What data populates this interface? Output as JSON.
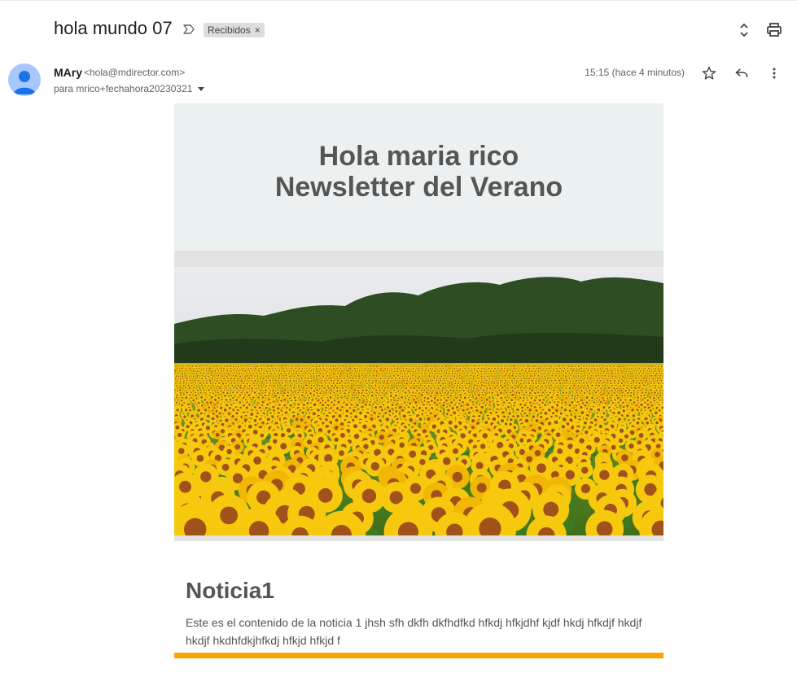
{
  "subject": "hola mundo 07",
  "label_chip": {
    "text": "Recibidos",
    "remove": "×"
  },
  "sender": {
    "name": "MAry",
    "email": "<hola@mdirector.com>",
    "recipient": "para mrico+fechahora20230321"
  },
  "timestamp": "15:15 (hace 4 minutos)",
  "icons": {
    "importance": "importance-marker-icon",
    "expand": "expand-collapse-icon",
    "print": "print-icon",
    "star": "star-icon",
    "reply": "reply-icon",
    "more": "more-vertical-icon",
    "recipient_dropdown": "caret-down-icon"
  },
  "newsletter": {
    "greeting": "Hola maria rico",
    "headline": "Newsletter del Verano",
    "image_alt": "Campo de girasoles",
    "article": {
      "title": "Noticia1",
      "body": "Este es el contenido de la noticia 1 jhsh sfh dkfh dkfhdfkd hfkdj hfkjdhf kjdf hkdj hfkdjf hkdjf hkdjf hkdhfdkjhfkdj hfkjd hfkjd f"
    }
  },
  "colors": {
    "header_bg": "#ebf1f0",
    "band_gray": "#e3e3e3",
    "text_gray": "#555555",
    "accent_orange": "#f9a602",
    "chip_bg": "#dddddd"
  }
}
